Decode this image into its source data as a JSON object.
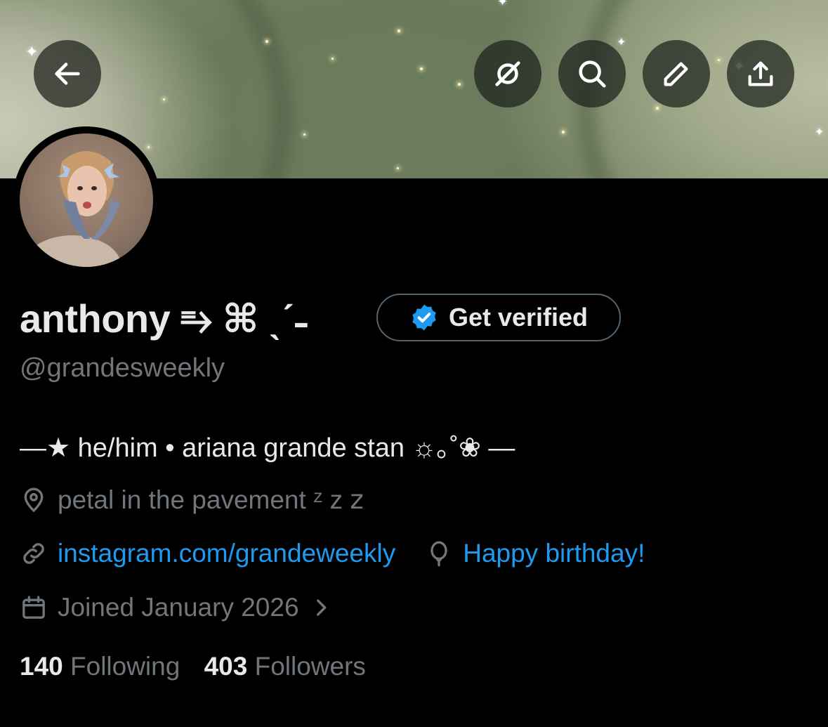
{
  "profile": {
    "display_name": "anthony ⥱ ⌘ ˎˊ˗",
    "handle": "@grandesweekly",
    "bio": "—★ he/him • ariana grande stan ☼｡˚❀ —",
    "location": "petal in the pavement ᶻ z 𝗓",
    "website": "instagram.com/grandeweekly",
    "birthday": "Happy birthday!",
    "joined": "Joined January 2026",
    "following_count": "140",
    "following_label": "Following",
    "followers_count": "403",
    "followers_label": "Followers"
  },
  "verify": {
    "label": "Get verified"
  },
  "icons": {
    "back": "arrow-left-icon",
    "grok": "grok-icon",
    "search": "search-icon",
    "edit": "pencil-icon",
    "share": "share-icon",
    "verified": "verified-badge-icon",
    "location": "location-pin-icon",
    "link": "link-icon",
    "birthday": "balloon-icon",
    "calendar": "calendar-icon",
    "chevron": "chevron-right-icon"
  },
  "colors": {
    "accent": "#1d9bf0",
    "muted": "#71767b",
    "text": "#e7e9ea",
    "background": "#000000"
  }
}
